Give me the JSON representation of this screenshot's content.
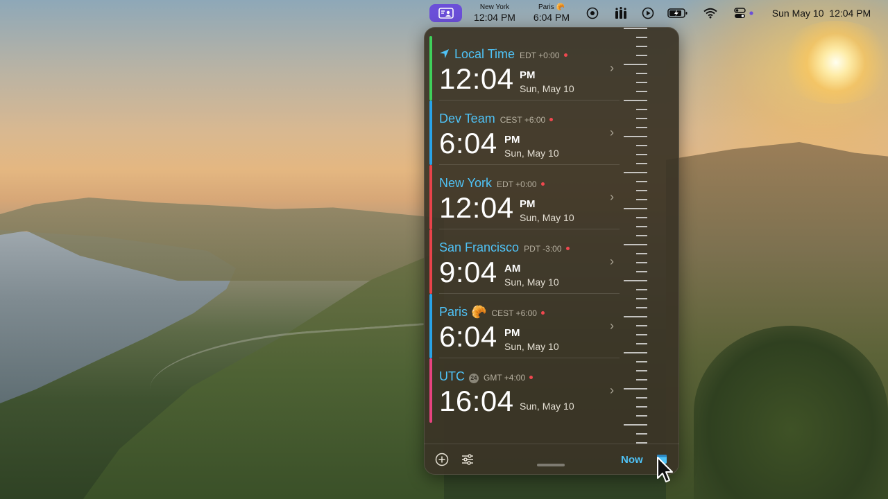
{
  "menubar": {
    "clocks": [
      {
        "city": "New York",
        "time": "12:04 PM"
      },
      {
        "city": "Paris 🥐",
        "time": "6:04 PM"
      }
    ],
    "date": "Sun May 10",
    "time": "12:04 PM",
    "icons": [
      "app-icon",
      "focus-icon",
      "candles-icon",
      "play-icon",
      "battery-icon",
      "wifi-icon",
      "control-center-icon"
    ]
  },
  "timezones": [
    {
      "name": "Local Time",
      "tz": "EDT +0:00",
      "time": "12:04",
      "meridiem": "PM",
      "day": "Sun, May 10",
      "color": "#3fd05a",
      "location": true
    },
    {
      "name": "Dev Team",
      "tz": "CEST +6:00",
      "time": "6:04",
      "meridiem": "PM",
      "day": "Sun, May 10",
      "color": "#29a3e8"
    },
    {
      "name": "New York",
      "tz": "EDT +0:00",
      "time": "12:04",
      "meridiem": "PM",
      "day": "Sun, May 10",
      "color": "#e8434a"
    },
    {
      "name": "San Francisco",
      "tz": "PDT -3:00",
      "time": "9:04",
      "meridiem": "AM",
      "day": "Sun, May 10",
      "color": "#e8434a"
    },
    {
      "name": "Paris 🥐",
      "tz": "CEST +6:00",
      "time": "6:04",
      "meridiem": "PM",
      "day": "Sun, May 10",
      "color": "#29a3e8"
    },
    {
      "name": "UTC",
      "badge": "24",
      "tz": "GMT +4:00",
      "time": "16:04",
      "meridiem": "",
      "day": "Sun, May 10",
      "color": "#e8437f"
    }
  ],
  "footer": {
    "now_label": "Now"
  }
}
